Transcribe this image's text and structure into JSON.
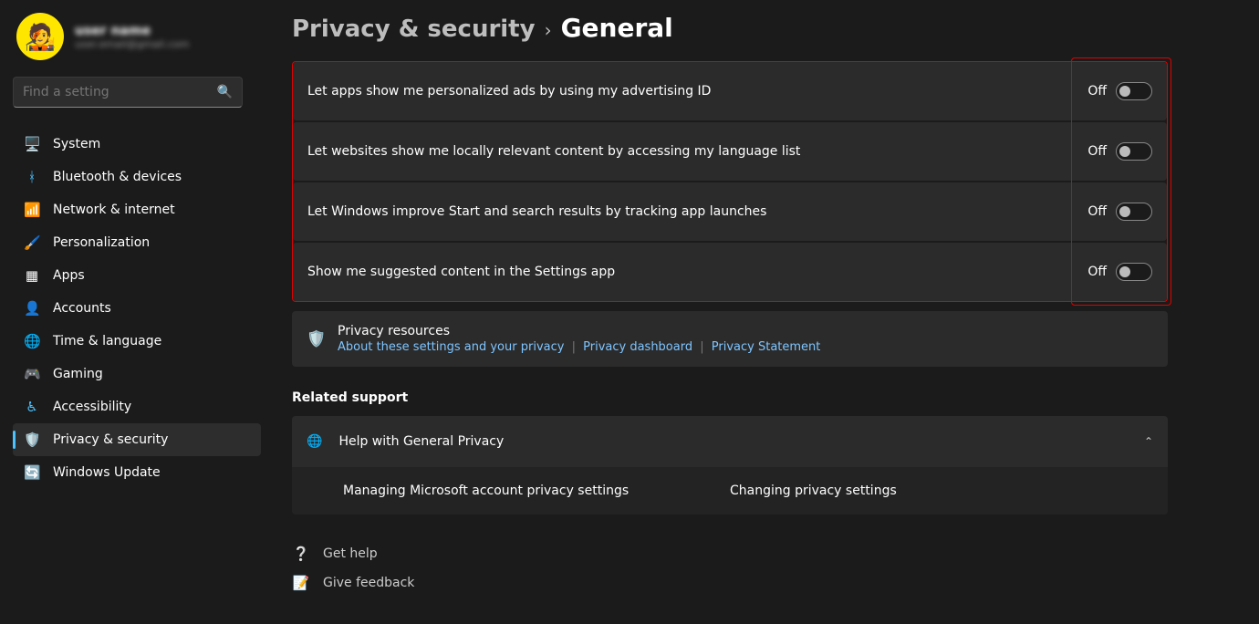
{
  "profile": {
    "name": "user name",
    "email": "user.email@gmail.com"
  },
  "search": {
    "placeholder": "Find a setting"
  },
  "nav": {
    "system": {
      "label": "System",
      "icon": "🖥️"
    },
    "bluetooth": {
      "label": "Bluetooth & devices",
      "icon": "ᚼ"
    },
    "network": {
      "label": "Network & internet",
      "icon": "📶"
    },
    "personalization": {
      "label": "Personalization",
      "icon": "🖌️"
    },
    "apps": {
      "label": "Apps",
      "icon": "▦"
    },
    "accounts": {
      "label": "Accounts",
      "icon": "👤"
    },
    "time": {
      "label": "Time & language",
      "icon": "🌐"
    },
    "gaming": {
      "label": "Gaming",
      "icon": "🎮"
    },
    "accessibility": {
      "label": "Accessibility",
      "icon": "♿"
    },
    "privacy": {
      "label": "Privacy & security",
      "icon": "🛡️"
    },
    "update": {
      "label": "Windows Update",
      "icon": "🔄"
    }
  },
  "breadcrumb": {
    "parent": "Privacy & security",
    "sep": "›",
    "current": "General"
  },
  "settings": [
    {
      "label": "Let apps show me personalized ads by using my advertising ID",
      "state": "Off"
    },
    {
      "label": "Let websites show me locally relevant content by accessing my language list",
      "state": "Off"
    },
    {
      "label": "Let Windows improve Start and search results by tracking app launches",
      "state": "Off"
    },
    {
      "label": "Show me suggested content in the Settings app",
      "state": "Off"
    }
  ],
  "resources": {
    "icon": "🛡️",
    "title": "Privacy resources",
    "links": [
      "About these settings and your privacy",
      "Privacy dashboard",
      "Privacy Statement"
    ]
  },
  "related": {
    "heading": "Related support",
    "expander": {
      "icon": "🌐",
      "title": "Help with General Privacy"
    },
    "items": [
      "Managing Microsoft account privacy settings",
      "Changing privacy settings"
    ]
  },
  "footer": {
    "help": {
      "icon": "❔",
      "label": "Get help"
    },
    "feedback": {
      "icon": "📝",
      "label": "Give feedback"
    }
  }
}
